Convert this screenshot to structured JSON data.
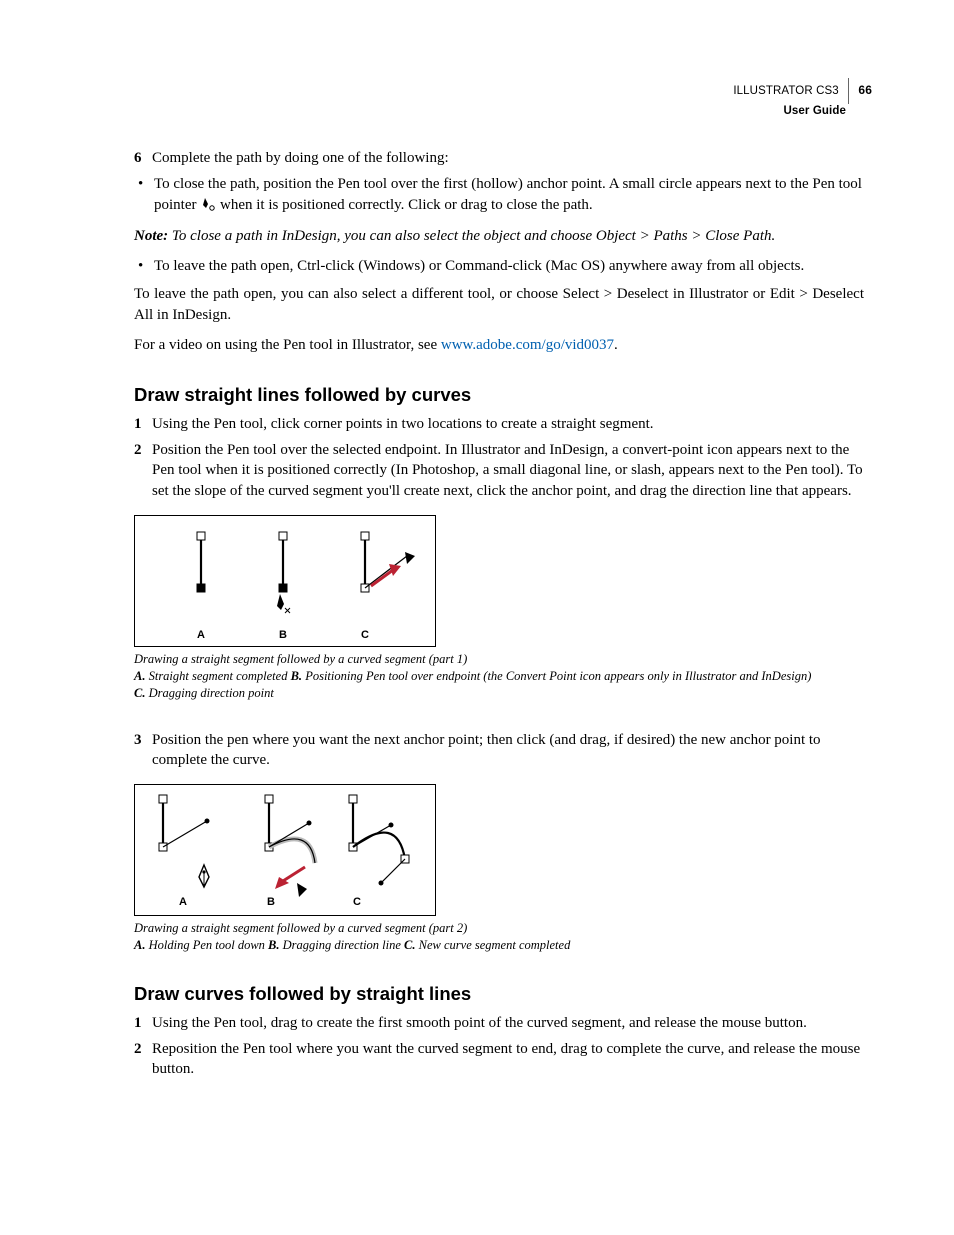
{
  "header": {
    "product": "ILLUSTRATOR CS3",
    "guide": "User Guide",
    "page": "66"
  },
  "intro": {
    "step6_text": "Complete the path by doing one of the following:",
    "bullet1": "To close the path, position the Pen tool over the first (hollow) anchor point. A small circle appears next to the Pen tool pointer ",
    "bullet1_tail": " when it is positioned correctly. Click or drag to close the path.",
    "note_label": "Note:",
    "note_text": " To close a path in InDesign, you can also select the object and choose Object > Paths > Close Path.",
    "bullet2": "To leave the path open, Ctrl-click (Windows) or Command-click (Mac OS) anywhere away from all objects.",
    "para_leave_open": "To leave the path open, you can also select a different tool, or choose Select > Deselect in Illustrator or Edit > Deselect All in InDesign.",
    "video_prefix": "For a video on using the Pen tool in Illustrator, see ",
    "video_link": "www.adobe.com/go/vid0037",
    "video_suffix": "."
  },
  "section1": {
    "title": "Draw straight lines followed by curves",
    "step1": "Using the Pen tool, click corner points in two locations to create a straight segment.",
    "step2": "Position the Pen tool over the selected endpoint. In Illustrator and InDesign, a convert-point icon appears next to the Pen tool when it is positioned correctly (In Photoshop, a small diagonal line, or slash, appears next to the Pen tool). To set the slope of the curved segment you'll create next, click the anchor point, and drag the direction line that appears.",
    "step3": "Position the pen where you want the next anchor point; then click (and drag, if desired) the new anchor point to complete the curve.",
    "fig_labels": {
      "a": "A",
      "b": "B",
      "c": "C"
    },
    "caption_title": "Drawing a straight segment followed by a curved segment (part 1)",
    "caption_a_lbl": "A.",
    "caption_a": " Straight segment completed  ",
    "caption_b_lbl": "B.",
    "caption_b": " Positioning Pen tool over endpoint (the Convert Point icon appears only in Illustrator and InDesign)  ",
    "caption_c_lbl": "C.",
    "caption_c": " Dragging direction point",
    "caption2_title": "Drawing a straight segment followed by a curved segment (part 2)",
    "caption2_a_lbl": "A.",
    "caption2_a": " Holding Pen tool down  ",
    "caption2_b_lbl": "B.",
    "caption2_b": " Dragging direction line  ",
    "caption2_c_lbl": "C.",
    "caption2_c": " New curve segment completed"
  },
  "section2": {
    "title": "Draw curves followed by straight lines",
    "step1": "Using the Pen tool, drag to create the first smooth point of the curved segment, and release the mouse button.",
    "step2": "Reposition the Pen tool where you want the curved segment to end, drag to complete the curve, and release the mouse button."
  }
}
